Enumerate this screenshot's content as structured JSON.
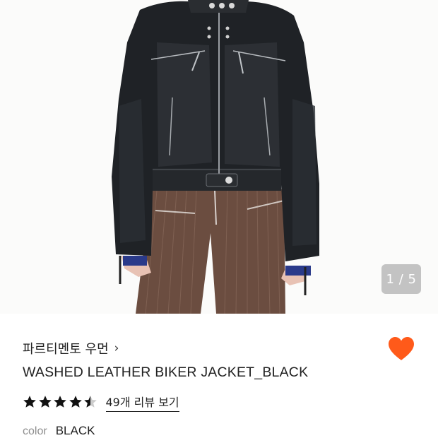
{
  "product": {
    "image_alt": "WASHED LEATHER BIKER JACKET_BLACK",
    "image_counter": "1 / 5",
    "brand": "파르티멘토 우먼",
    "brand_chevron": "›",
    "title": "WASHED LEATHER BIKER JACKET_BLACK",
    "rating": {
      "value": 4.5,
      "max": 5
    },
    "review_link": "49개 리뷰 보기",
    "color_label": "color",
    "color_value": "BLACK"
  },
  "colors": {
    "accent_heart": "#ff5a1a",
    "star": "#111111",
    "star_empty": "#cccccc",
    "muted_text": "#8e8e8e"
  },
  "icons": {
    "wishlist": "heart-icon",
    "brand_link": "chevron-right-icon",
    "rating": "star-icon"
  }
}
